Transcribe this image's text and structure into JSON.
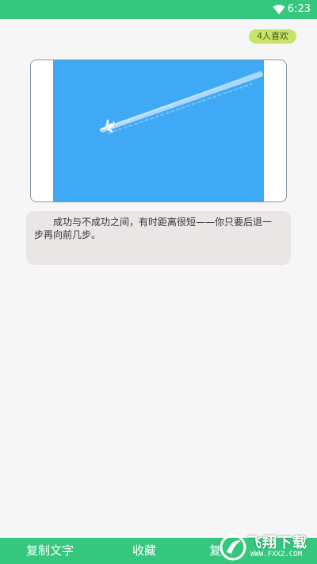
{
  "status_bar": {
    "time": "6:23",
    "icons": [
      "wifi-icon"
    ]
  },
  "like_badge": "4人喜欢",
  "image": {
    "icon": "airplane-contrail-image",
    "colors": {
      "sky": "#3fa9f5",
      "frame_border": "#8a9aa8"
    }
  },
  "quote": {
    "text": "成功与不成功之间，有时距离很短——你只要后退一步再向前几步。"
  },
  "bottom_bar": {
    "tabs": [
      "复制文字",
      "收藏",
      "复"
    ]
  },
  "watermark": {
    "brand": "飞翔下载",
    "url": "WWW.FXXZ.COM"
  },
  "colors": {
    "accent": "#35c77e",
    "badge": "#c7e36a",
    "quote_bg": "#ebe6e6"
  }
}
